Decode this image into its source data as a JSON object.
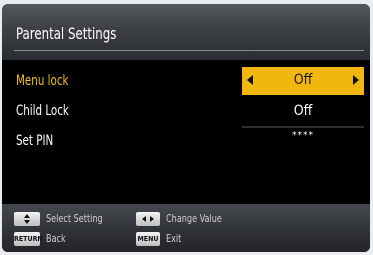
{
  "window": {
    "title": "Parental Settings"
  },
  "settings": {
    "items": [
      {
        "label": "Menu lock",
        "value": "Off"
      },
      {
        "label": "Child Lock",
        "value": "Off"
      },
      {
        "label": "Set PIN",
        "value": "****"
      }
    ]
  },
  "footer": {
    "hints": [
      {
        "key": "up-down-keys",
        "key_text": "",
        "label": "Select Setting"
      },
      {
        "key": "left-right-keys",
        "key_text": "",
        "label": "Change Value"
      },
      {
        "key": "return-key",
        "key_text": "RETURN",
        "label": "Back"
      },
      {
        "key": "menu-key",
        "key_text": "MENU",
        "label": "Exit"
      }
    ]
  },
  "colors": {
    "accent": "#f2b70e",
    "selected_label": "#f0c21a",
    "background": "#000000"
  }
}
